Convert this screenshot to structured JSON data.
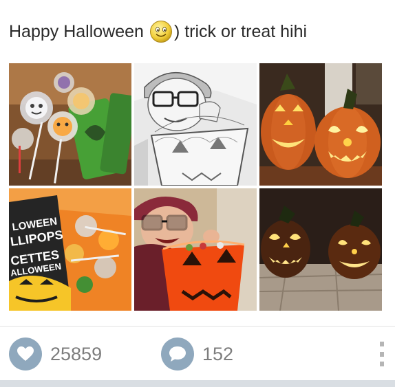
{
  "post": {
    "caption_before": "Happy Halloween",
    "caption_after": ") trick or treat hihi",
    "photos": [
      {
        "name": "lollipops-photo"
      },
      {
        "name": "sketch-selfie-photo"
      },
      {
        "name": "pumpkins-lit-photo"
      },
      {
        "name": "halloween-candy-bag-photo"
      },
      {
        "name": "girl-with-bucket-photo"
      },
      {
        "name": "pumpkins-dark-photo"
      }
    ]
  },
  "actions": {
    "likes": "25859",
    "comments": "152"
  },
  "colors": {
    "icon_bg": "#8fa8bd",
    "count_text": "#7d7d7d",
    "caption_text": "#2b2b2b"
  },
  "icons": {
    "emoji": "smiley-emoji-icon",
    "like": "heart-icon",
    "comment": "speech-bubble-icon",
    "more": "more-vertical-icon"
  }
}
